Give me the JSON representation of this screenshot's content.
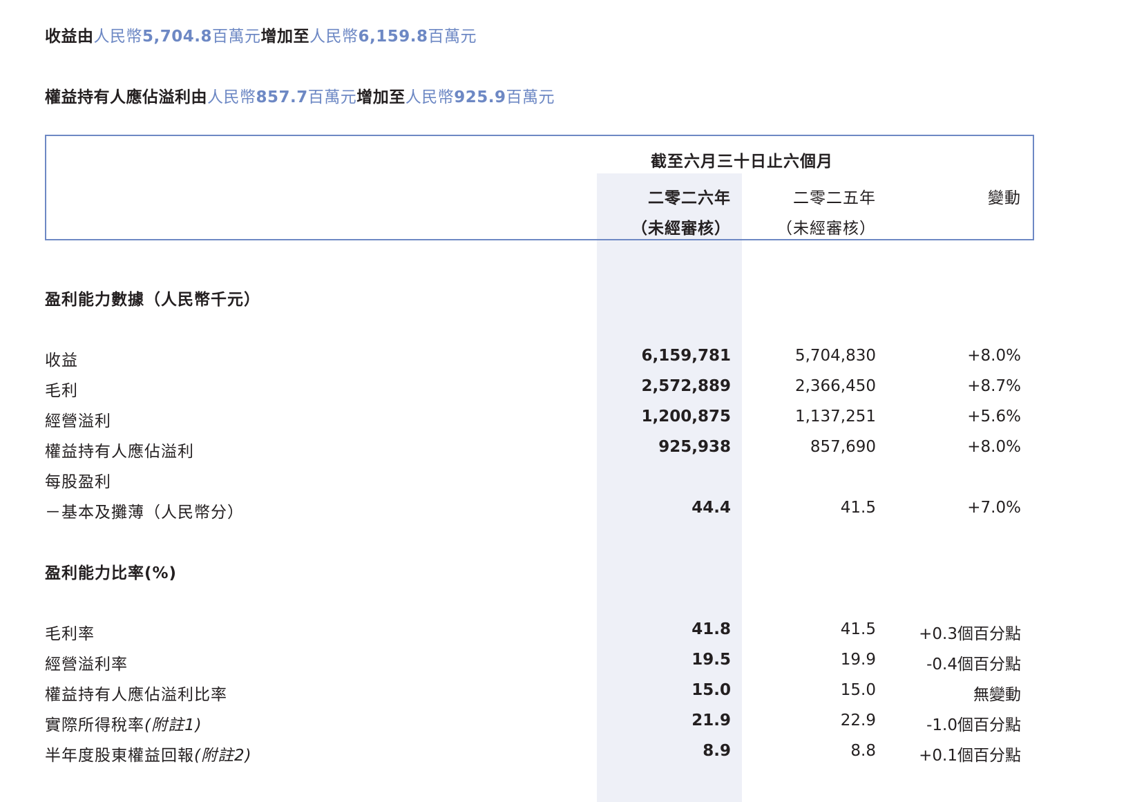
{
  "headlines": {
    "revenue": {
      "p1": "收益由",
      "p2": "人民幣",
      "n1": "5,704.8",
      "p3": "百萬元",
      "p4": "增加至",
      "p5": "人民幣",
      "n2": "6,159.8",
      "p6": "百萬元"
    },
    "profit": {
      "p1": "權益持有人應佔溢利由",
      "p2": "人民幣",
      "n1": "857.7",
      "p3": "百萬元",
      "p4": "增加至",
      "p5": "人民幣",
      "n2": "925.9",
      "p6": "百萬元"
    }
  },
  "table_header": {
    "period": "截至六月三十日止六個月",
    "col1_year": "二零二六年",
    "col1_note": "（未經審核）",
    "col2_year": "二零二五年",
    "col2_note": "（未經審核）",
    "col3": "變動"
  },
  "section1": {
    "title": "盈利能力數據（人民幣千元）",
    "rows": [
      {
        "label": "收益",
        "v1": "6,159,781",
        "v2": "5,704,830",
        "v3": "+8.0%"
      },
      {
        "label": "毛利",
        "v1": "2,572,889",
        "v2": "2,366,450",
        "v3": "+8.7%"
      },
      {
        "label": "經營溢利",
        "v1": "1,200,875",
        "v2": "1,137,251",
        "v3": "+5.6%"
      },
      {
        "label": "權益持有人應佔溢利",
        "v1": "925,938",
        "v2": "857,690",
        "v3": "+8.0%"
      },
      {
        "label": "每股盈利",
        "v1": "",
        "v2": "",
        "v3": ""
      },
      {
        "label": "－基本及攤薄（人民幣分）",
        "v1": "44.4",
        "v2": "41.5",
        "v3": "+7.0%"
      }
    ]
  },
  "section2": {
    "title": "盈利能力比率(%)",
    "rows": [
      {
        "label": "毛利率",
        "note": "",
        "v1": "41.8",
        "v2": "41.5",
        "v3": "+0.3個百分點"
      },
      {
        "label": "經營溢利率",
        "note": "",
        "v1": "19.5",
        "v2": "19.9",
        "v3": "-0.4個百分點"
      },
      {
        "label": "權益持有人應佔溢利比率",
        "note": "",
        "v1": "15.0",
        "v2": "15.0",
        "v3": "無變動"
      },
      {
        "label": "實際所得稅率",
        "note": "(附註1)",
        "v1": "21.9",
        "v2": "22.9",
        "v3": "-1.0個百分點"
      },
      {
        "label": "半年度股東權益回報",
        "note": "(附註2)",
        "v1": "8.9",
        "v2": "8.8",
        "v3": "+0.1個百分點"
      }
    ]
  },
  "colors": {
    "accent_blue": "#6d88c4",
    "column_shade": "#eef0f7",
    "text": "#231f20"
  }
}
